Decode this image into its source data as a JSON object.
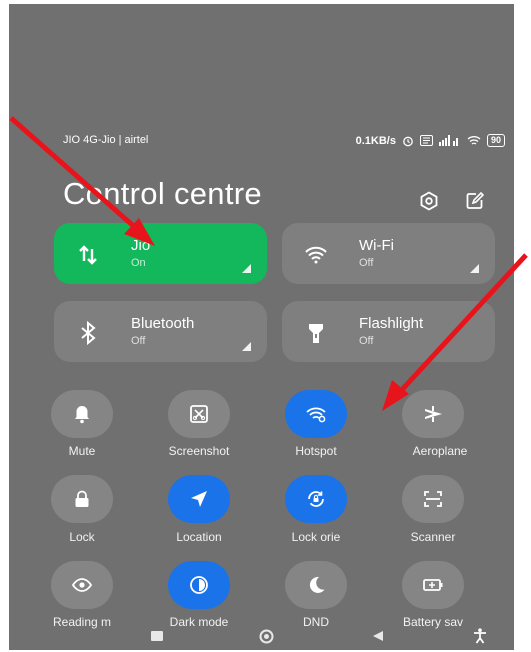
{
  "status_bar": {
    "carrier": "JIO 4G-Jio | airtel",
    "speed": "0.1KB/s",
    "battery": "90"
  },
  "header": {
    "title": "Control centre"
  },
  "big_tiles": [
    {
      "name": "Jio",
      "state": "On",
      "icon": "mobile-data-icon",
      "active": true
    },
    {
      "name": "Wi-Fi",
      "state": "Off",
      "icon": "wifi-icon",
      "active": false
    },
    {
      "name": "Bluetooth",
      "state": "Off",
      "icon": "bluetooth-icon",
      "active": false
    },
    {
      "name": "Flashlight",
      "state": "Off",
      "icon": "flashlight-icon",
      "active": false
    }
  ],
  "toggles": [
    {
      "label": "Mute",
      "icon": "bell-icon",
      "active": false
    },
    {
      "label": "Screenshot",
      "icon": "screenshot-icon",
      "active": false
    },
    {
      "label": "Hotspot",
      "icon": "hotspot-icon",
      "active": true
    },
    {
      "label": "Aeroplane",
      "icon": "airplane-icon",
      "active": false
    },
    {
      "label": "Lock",
      "icon": "lock-icon",
      "active": false
    },
    {
      "label": "Location",
      "icon": "location-arrow-icon",
      "active": true
    },
    {
      "label": "Lock orie",
      "icon": "rotation-lock-icon",
      "active": true
    },
    {
      "label": "Scanner",
      "icon": "scanner-icon",
      "active": false
    },
    {
      "label": "Reading m",
      "icon": "eye-icon",
      "active": false
    },
    {
      "label": "Dark mode",
      "icon": "dark-mode-icon",
      "active": true
    },
    {
      "label": "DND",
      "icon": "moon-icon",
      "active": false
    },
    {
      "label": "Battery sav",
      "icon": "battery-icon",
      "active": false
    }
  ],
  "colors": {
    "background": "#707070",
    "active_green": "#14b85c",
    "active_blue": "#1a73e8",
    "annotation_arrow": "#e8141b"
  }
}
